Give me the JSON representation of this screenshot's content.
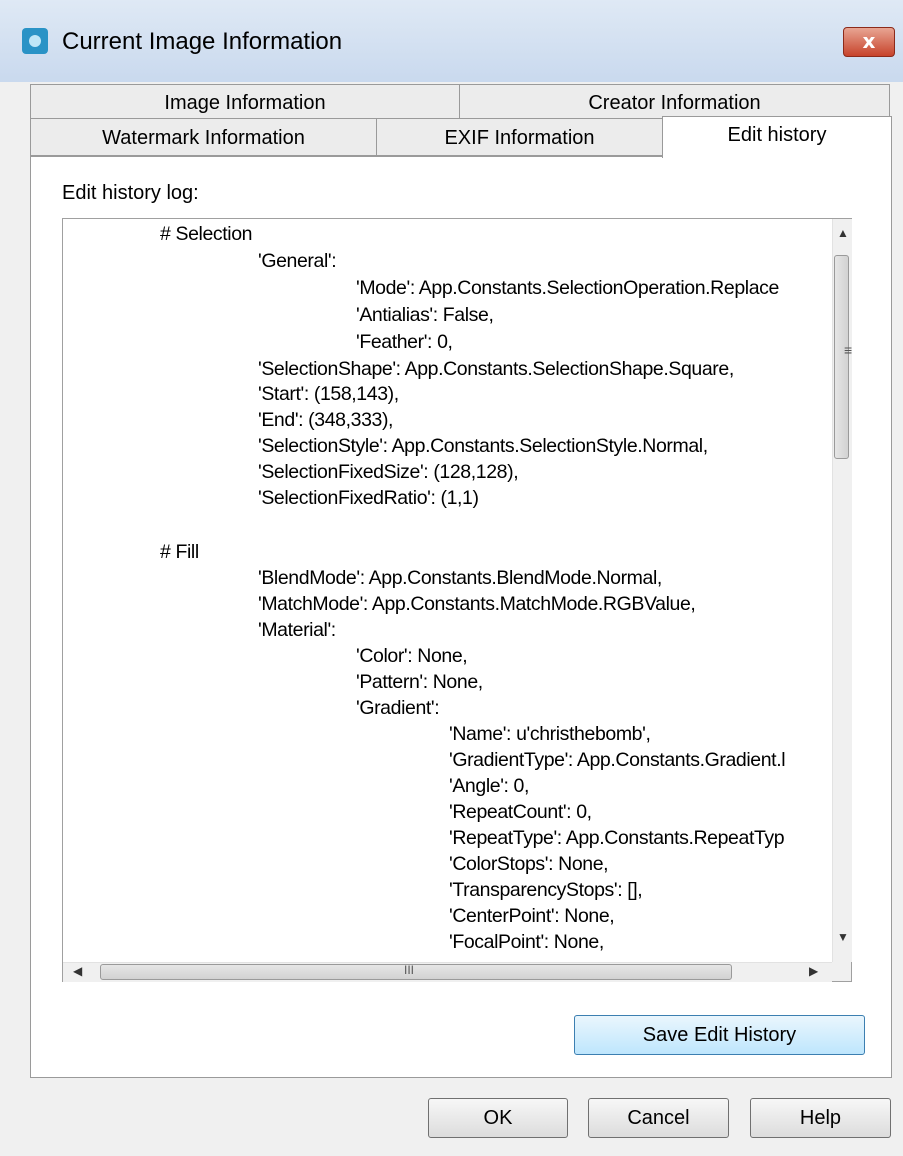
{
  "window": {
    "title": "Current Image Information",
    "close_glyph": "x"
  },
  "tabs": {
    "row1": [
      "Image Information",
      "Creator Information"
    ],
    "row2": [
      "Watermark Information",
      "EXIF Information",
      "Edit history"
    ],
    "active": "Edit history"
  },
  "log": {
    "label": "Edit history log:",
    "lines": [
      "# Selection",
      "'General':",
      "'Mode': App.Constants.SelectionOperation.Replace",
      "'Antialias': False,",
      "'Feather': 0,",
      "'SelectionShape': App.Constants.SelectionShape.Square,",
      "'Start': (158,143),",
      "'End': (348,333),",
      "'SelectionStyle': App.Constants.SelectionStyle.Normal,",
      "'SelectionFixedSize': (128,128),",
      "'SelectionFixedRatio': (1,1)",
      "# Fill",
      "'BlendMode': App.Constants.BlendMode.Normal,",
      "'MatchMode': App.Constants.MatchMode.RGBValue,",
      "'Material':",
      "'Color': None,",
      "'Pattern': None,",
      "'Gradient':",
      "'Name': u'christhebomb',",
      "'GradientType': App.Constants.Gradient.l",
      "'Angle': 0,",
      "'RepeatCount': 0,",
      "'RepeatType': App.Constants.RepeatTyp",
      "'ColorStops': None,",
      "'TransparencyStops': [],",
      "'CenterPoint': None,",
      "'FocalPoint': None,"
    ]
  },
  "scrollbars": {
    "vertical_thumb_glyph": "≡",
    "horizontal_thumb_glyph": "III"
  },
  "buttons": {
    "save_edit_history": "Save Edit History",
    "ok": "OK",
    "cancel": "Cancel",
    "help": "Help"
  },
  "colors": {
    "titlebar": "#c9d9ee",
    "close_button": "#c7432b",
    "save_button": "#bee6fd"
  }
}
